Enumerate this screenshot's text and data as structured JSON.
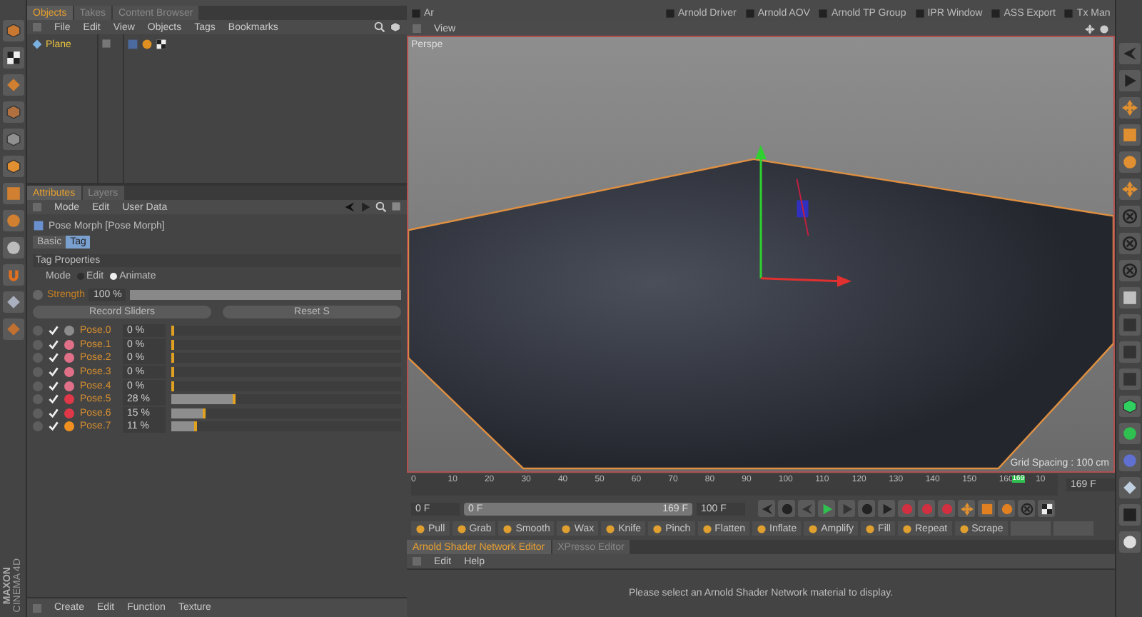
{
  "top_bar": {
    "items": [
      {
        "label": "Ar"
      },
      {
        "label": "Arnold Driver"
      },
      {
        "label": "Arnold AOV"
      },
      {
        "label": "Arnold TP Group"
      },
      {
        "label": "IPR Window"
      },
      {
        "label": "ASS Export"
      },
      {
        "label": "Tx Man"
      }
    ]
  },
  "objects_panel": {
    "tabs": [
      {
        "label": "Objects",
        "selected": true
      },
      {
        "label": "Takes",
        "selected": false
      },
      {
        "label": "Content Browser",
        "selected": false
      }
    ],
    "menu": [
      "File",
      "Edit",
      "View",
      "Objects",
      "Tags",
      "Bookmarks"
    ],
    "objects": [
      {
        "name": "Plane"
      }
    ]
  },
  "attributes_panel": {
    "tabs": [
      {
        "label": "Attributes",
        "selected": true
      },
      {
        "label": "Layers",
        "selected": false
      }
    ],
    "menu": [
      "Mode",
      "Edit",
      "User Data"
    ],
    "title": "Pose Morph [Pose Morph]",
    "subtabs": [
      {
        "label": "Basic",
        "selected": false
      },
      {
        "label": "Tag",
        "selected": true
      }
    ],
    "section": "Tag Properties",
    "mode": {
      "label": "Mode",
      "options": [
        {
          "label": "Edit",
          "selected": false
        },
        {
          "label": "Animate",
          "selected": true
        }
      ]
    },
    "strength": {
      "label": "Strength",
      "value": "100 %",
      "level": 1
    },
    "buttons": [
      "Record Sliders",
      "Reset S"
    ],
    "poses": [
      {
        "name": "Pose.0",
        "value": "0 %",
        "level": 0,
        "checked": true,
        "color": "#8c8c8c"
      },
      {
        "name": "Pose.1",
        "value": "0 %",
        "level": 0,
        "checked": true,
        "color": "#e07088"
      },
      {
        "name": "Pose.2",
        "value": "0 %",
        "level": 0,
        "checked": true,
        "color": "#e07088"
      },
      {
        "name": "Pose.3",
        "value": "0 %",
        "level": 0,
        "checked": true,
        "color": "#e07088"
      },
      {
        "name": "Pose.4",
        "value": "0 %",
        "level": 0,
        "checked": true,
        "color": "#e07088"
      },
      {
        "name": "Pose.5",
        "value": "28 %",
        "level": 0.28,
        "checked": true,
        "color": "#e03848"
      },
      {
        "name": "Pose.6",
        "value": "15 %",
        "level": 0.15,
        "checked": true,
        "color": "#e03848"
      },
      {
        "name": "Pose.7",
        "value": "11 %",
        "level": 0.11,
        "checked": true,
        "color": "#f09020"
      }
    ]
  },
  "viewport": {
    "menu": [
      "View"
    ],
    "camera": "Perspe",
    "grid_spacing": "Grid Spacing : 100 cm"
  },
  "timeline": {
    "ticks": [
      "0",
      "10",
      "20",
      "30",
      "40",
      "50",
      "60",
      "70",
      "80",
      "90",
      "100",
      "110",
      "120",
      "130",
      "140",
      "150",
      "160",
      "10"
    ],
    "playhead": {
      "label": "169",
      "level": 0.93
    },
    "end_field": "169 F"
  },
  "transport": {
    "start_field": "0 F",
    "range": {
      "start": "0 F",
      "end": "169 F",
      "level": 1
    },
    "end_field": "100 F"
  },
  "sculpt_tools": [
    "Pull",
    "Grab",
    "Smooth",
    "Wax",
    "Knife",
    "Pinch",
    "Flatten",
    "Inflate",
    "Amplify",
    "Fill",
    "Repeat",
    "Scrape"
  ],
  "node_editor": {
    "tabs": [
      {
        "label": "Arnold Shader Network Editor",
        "selected": true
      },
      {
        "label": "XPresso Editor",
        "selected": false
      }
    ],
    "menu": [
      "Edit",
      "Help"
    ],
    "message": "Please select an Arnold Shader Network material to display."
  },
  "material_manager": {
    "menu": [
      "Create",
      "Edit",
      "Function",
      "Texture"
    ]
  },
  "logo": {
    "brand": "MAXON",
    "product": "CINEMA 4D"
  }
}
